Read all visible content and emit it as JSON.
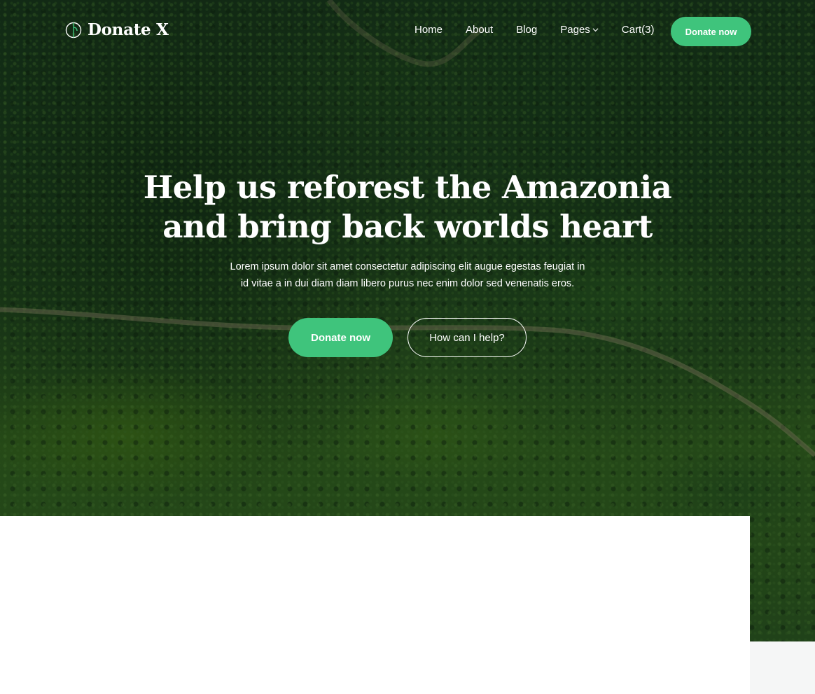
{
  "brand": {
    "name": "Donate X",
    "logo_icon": "leaf-circle-icon",
    "accent_color": "#3fc47c"
  },
  "nav": {
    "links": [
      {
        "label": "Home"
      },
      {
        "label": "About"
      },
      {
        "label": "Blog"
      },
      {
        "label": "Pages",
        "icon": "chevron-down-icon"
      },
      {
        "label": "Cart(3)"
      }
    ],
    "cta_label": "Donate now"
  },
  "hero": {
    "title_line1": "Help us reforest the Amazonia",
    "title_line2": "and bring back worlds heart",
    "subtitle_line1": "Lorem ipsum dolor sit amet consectetur adipiscing elit augue egestas feugiat in",
    "subtitle_line2": "id vitae a in dui diam diam libero purus nec enim dolor sed venenatis eros.",
    "primary_button": "Donate now",
    "secondary_button": "How can I help?"
  }
}
